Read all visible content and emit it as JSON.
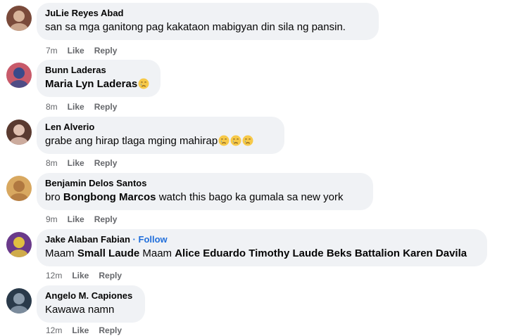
{
  "comments": [
    {
      "author": "JuLie Reyes Abad",
      "text_parts": [
        {
          "t": "san sa mga ganitong pag kakataon mabigyan din sila ng pansin.",
          "b": false
        }
      ],
      "emoji": [],
      "time": "7m",
      "like": "Like",
      "reply": "Reply",
      "avatar_colors": [
        "#7a4a3a",
        "#d8b49a"
      ]
    },
    {
      "author": "Bunn Laderas",
      "text_parts": [
        {
          "t": "Maria Lyn Laderas",
          "b": true
        }
      ],
      "emoji": [
        "crying-face-icon"
      ],
      "time": "8m",
      "like": "Like",
      "reply": "Reply",
      "avatar_colors": [
        "#c85a6a",
        "#3a4a8a"
      ]
    },
    {
      "author": "Len Alverio",
      "text_parts": [
        {
          "t": "grabe ang hirap tlaga mging mahirap",
          "b": false
        }
      ],
      "emoji": [
        "crying-face-icon",
        "crying-face-icon",
        "crying-face-icon"
      ],
      "time": "8m",
      "like": "Like",
      "reply": "Reply",
      "avatar_colors": [
        "#5a3a30",
        "#e0c0b0"
      ]
    },
    {
      "author": "Benjamin Delos Santos",
      "text_parts": [
        {
          "t": "bro ",
          "b": false
        },
        {
          "t": "Bongbong Marcos",
          "b": true
        },
        {
          "t": " watch this bago ka gumala sa new york",
          "b": false
        }
      ],
      "emoji": [],
      "time": "9m",
      "like": "Like",
      "reply": "Reply",
      "avatar_colors": [
        "#d8a860",
        "#b07840"
      ]
    },
    {
      "author": "Jake Alaban Fabian",
      "separator": "·",
      "follow": "Follow",
      "text_parts": [
        {
          "t": "Maam ",
          "b": false
        },
        {
          "t": "Small Laude",
          "b": true
        },
        {
          "t": " Maam ",
          "b": false
        },
        {
          "t": "Alice Eduardo",
          "b": true
        },
        {
          "t": " ",
          "b": false
        },
        {
          "t": "Timothy Laude",
          "b": true
        },
        {
          "t": " ",
          "b": false
        },
        {
          "t": "Beks Battalion",
          "b": true
        },
        {
          "t": " ",
          "b": false
        },
        {
          "t": "Karen Davila",
          "b": true
        }
      ],
      "emoji": [],
      "time": "12m",
      "like": "Like",
      "reply": "Reply",
      "avatar_colors": [
        "#6a3a8a",
        "#e0c040"
      ]
    },
    {
      "author": "Angelo M. Capiones",
      "text_parts": [
        {
          "t": "Kawawa namn",
          "b": false
        }
      ],
      "emoji": [],
      "time": "12m",
      "like": "Like",
      "reply": "Reply",
      "avatar_colors": [
        "#2a3a4a",
        "#8a9aaa"
      ]
    }
  ],
  "colors": {
    "bubble": "#f0f2f5",
    "meta": "#65676b",
    "follow": "#216fdb"
  }
}
